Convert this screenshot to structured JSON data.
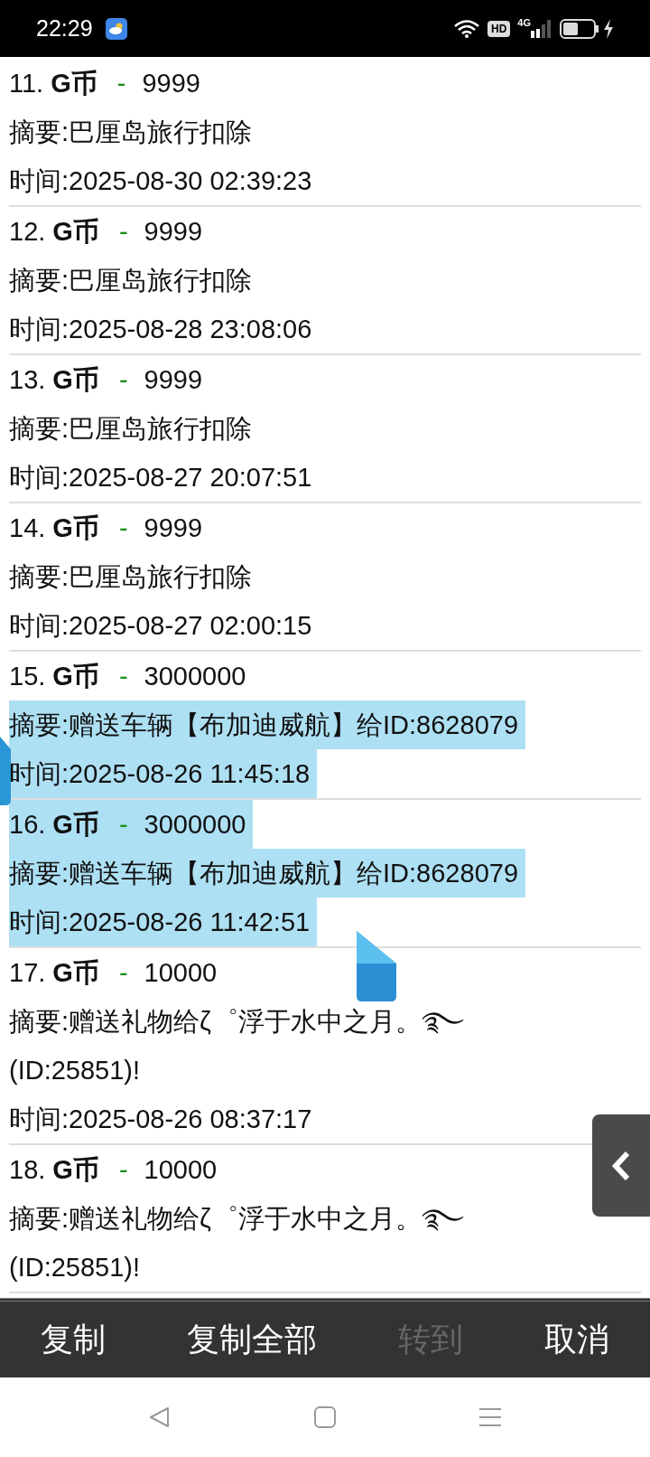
{
  "status_bar": {
    "time": "22:29",
    "hd": "HD",
    "network": "4G"
  },
  "entries": [
    {
      "index": "11.",
      "currency": "G币",
      "sign": "-",
      "amount": "9999",
      "summary": "摘要:巴厘岛旅行扣除",
      "time": "时间:2025-08-30 02:39:23",
      "title_selected": false,
      "summary_selected": false,
      "time_selected": false
    },
    {
      "index": "12.",
      "currency": "G币",
      "sign": "-",
      "amount": "9999",
      "summary": "摘要:巴厘岛旅行扣除",
      "time": "时间:2025-08-28 23:08:06",
      "title_selected": false,
      "summary_selected": false,
      "time_selected": false
    },
    {
      "index": "13.",
      "currency": "G币",
      "sign": "-",
      "amount": "9999",
      "summary": "摘要:巴厘岛旅行扣除",
      "time": "时间:2025-08-27 20:07:51",
      "title_selected": false,
      "summary_selected": false,
      "time_selected": false
    },
    {
      "index": "14.",
      "currency": "G币",
      "sign": "-",
      "amount": "9999",
      "summary": "摘要:巴厘岛旅行扣除",
      "time": "时间:2025-08-27 02:00:15",
      "title_selected": false,
      "summary_selected": false,
      "time_selected": false
    },
    {
      "index": "15.",
      "currency": "G币",
      "sign": "-",
      "amount": "3000000",
      "summary": "摘要:赠送车辆【布加迪威航】给ID:8628079",
      "time": "时间:2025-08-26 11:45:18",
      "title_selected": false,
      "summary_selected": true,
      "time_selected": true
    },
    {
      "index": "16.",
      "currency": "G币",
      "sign": "-",
      "amount": "3000000",
      "summary": "摘要:赠送车辆【布加迪威航】给ID:8628079",
      "time": "时间:2025-08-26 11:42:51",
      "title_selected": true,
      "summary_selected": true,
      "time_selected": true
    },
    {
      "index": "17.",
      "currency": "G币",
      "sign": "-",
      "amount": "10000",
      "summary": "摘要:赠送礼物给ζ゜浮于水中之月。࿐\n(ID:25851)!",
      "time": "时间:2025-08-26 08:37:17",
      "title_selected": false,
      "summary_selected": false,
      "time_selected": false
    },
    {
      "index": "18.",
      "currency": "G币",
      "sign": "-",
      "amount": "10000",
      "summary": "摘要:赠送礼物给ζ゜浮于水中之月。࿐\n(ID:25851)!",
      "title_selected": false,
      "summary_selected": false
    }
  ],
  "action_bar": [
    {
      "label": "复制",
      "disabled": false
    },
    {
      "label": "复制全部",
      "disabled": false
    },
    {
      "label": "转到",
      "disabled": true
    },
    {
      "label": "取消",
      "disabled": false
    }
  ]
}
